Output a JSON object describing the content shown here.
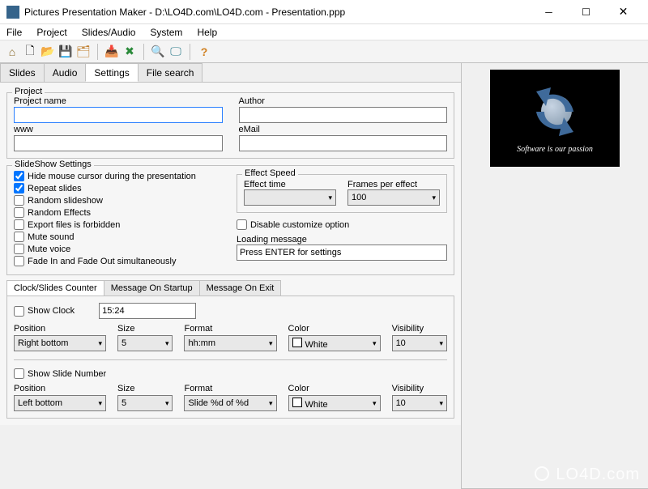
{
  "window": {
    "title": "Pictures Presentation Maker - D:\\LO4D.com\\LO4D.com - Presentation.ppp"
  },
  "menu": {
    "file": "File",
    "project": "Project",
    "slides_audio": "Slides/Audio",
    "system": "System",
    "help": "Help"
  },
  "tabs": {
    "slides": "Slides",
    "audio": "Audio",
    "settings": "Settings",
    "file_search": "File search"
  },
  "project": {
    "legend": "Project",
    "name_label": "Project name",
    "name_value": "",
    "www_label": "www",
    "www_value": "",
    "author_label": "Author",
    "author_value": "",
    "email_label": "eMail",
    "email_value": ""
  },
  "slideshow": {
    "legend": "SlideShow Settings",
    "hide_cursor": "Hide mouse cursor during the presentation",
    "repeat": "Repeat slides",
    "random_slideshow": "Random slideshow",
    "random_effects": "Random Effects",
    "export_forbidden": "Export files is forbidden",
    "mute_sound": "Mute sound",
    "mute_voice": "Mute voice",
    "fade": "Fade In and Fade Out simultaneously",
    "effect_legend": "Effect Speed",
    "effect_time_label": "Effect time",
    "effect_time_value": "",
    "fpe_label": "Frames per effect",
    "fpe_value": "100",
    "disable_custom": "Disable customize option",
    "loading_label": "Loading message",
    "loading_value": "Press ENTER for settings"
  },
  "subtabs": {
    "clock": "Clock/Slides Counter",
    "startup": "Message On Startup",
    "exit": "Message On Exit"
  },
  "clock": {
    "show_clock": "Show Clock",
    "time_value": "15:24",
    "position_label": "Position",
    "position_value": "Right bottom",
    "size_label": "Size",
    "size_value": "5",
    "format_label": "Format",
    "format_value": "hh:mm",
    "color_label": "Color",
    "color_value": "White",
    "visibility_label": "Visibility",
    "visibility_value": "10"
  },
  "slide_no": {
    "show": "Show Slide Number",
    "position_label": "Position",
    "position_value": "Left bottom",
    "size_label": "Size",
    "size_value": "5",
    "format_label": "Format",
    "format_value": "Slide %d of %d",
    "color_label": "Color",
    "color_value": "White",
    "visibility_label": "Visibility",
    "visibility_value": "10"
  },
  "preview": {
    "caption": "Software is our passion"
  },
  "watermark": "LO4D.com"
}
